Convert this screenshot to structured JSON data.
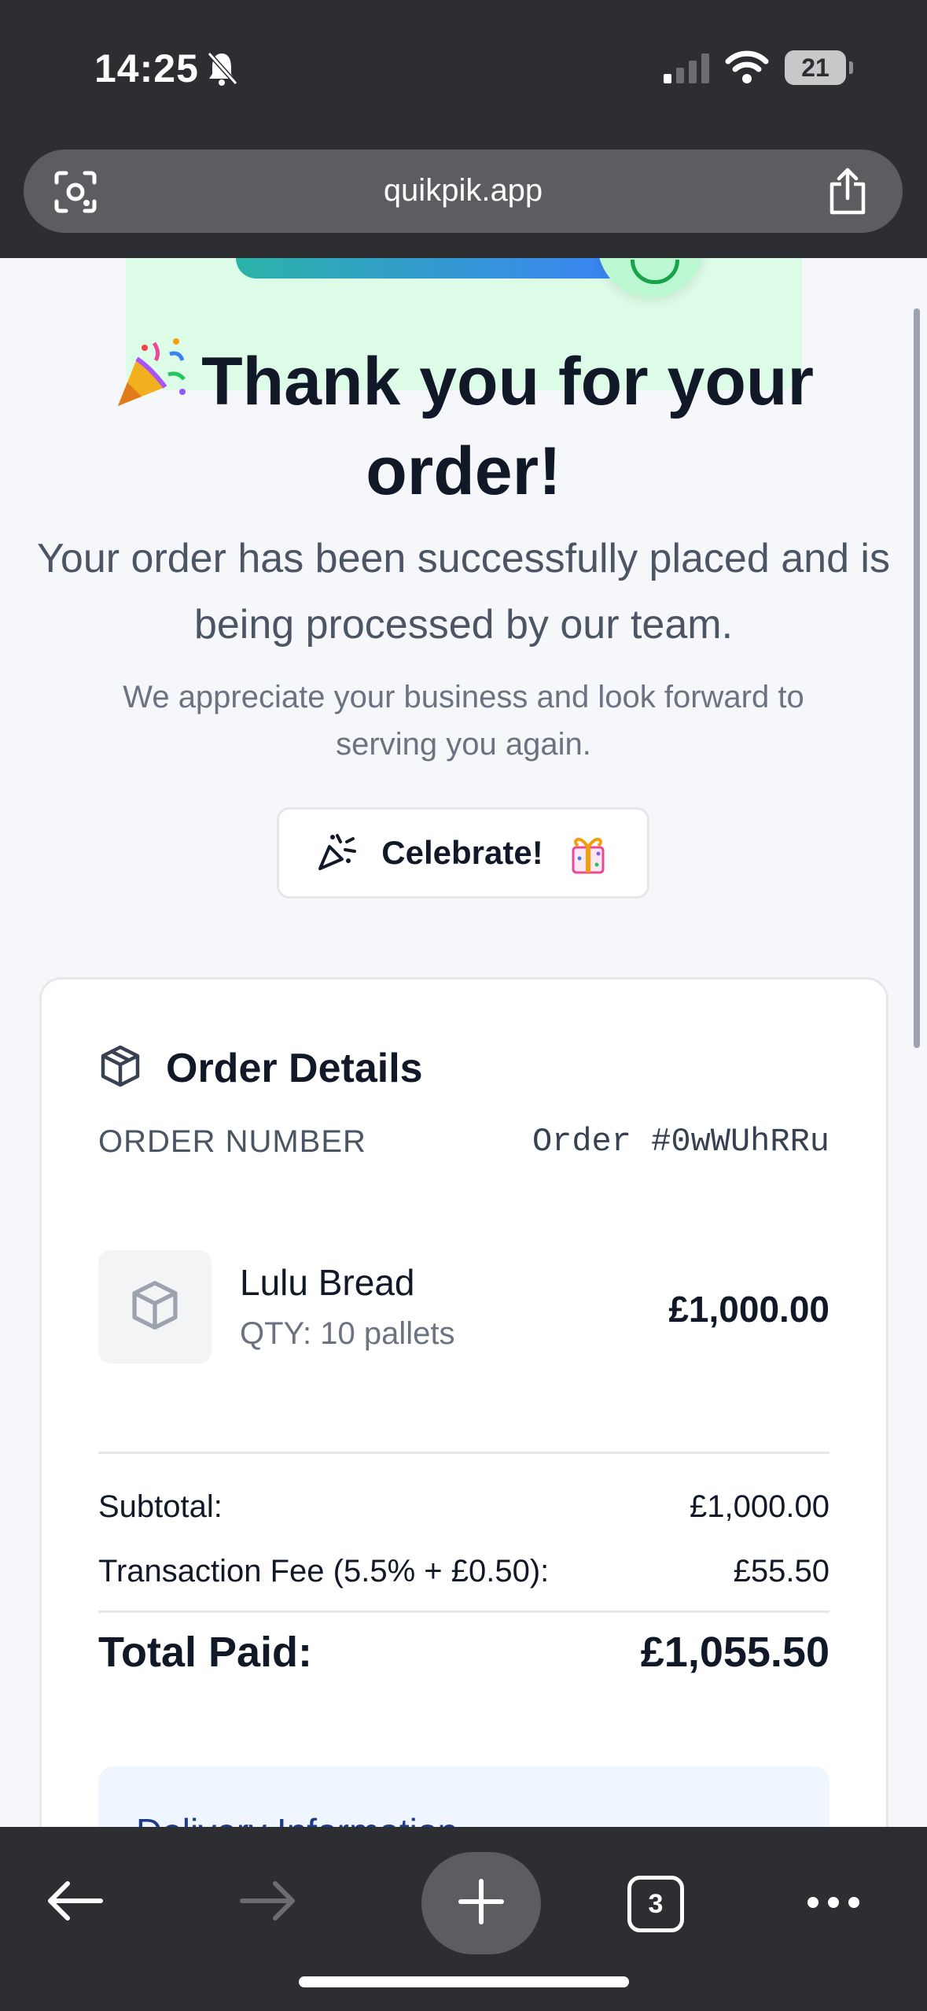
{
  "status_bar": {
    "time": "14:25",
    "battery": "21"
  },
  "browser": {
    "url": "quikpik.app",
    "tab_count": "3"
  },
  "confirmation": {
    "title": "Thank you for your order!",
    "message": "Your order has been successfully placed and is being processed by our team.",
    "appreciation": "We appreciate your business and look forward to serving you again.",
    "celebrate_label": "Celebrate!"
  },
  "order": {
    "section_title": "Order Details",
    "order_number_label": "ORDER NUMBER",
    "order_number": "Order #0wWUhRRu",
    "item": {
      "name": "Lulu Bread",
      "qty": "QTY: 10 pallets",
      "price": "£1,000.00"
    },
    "subtotal_label": "Subtotal:",
    "subtotal_value": "£1,000.00",
    "fee_label": "Transaction Fee (5.5% + £0.50):",
    "fee_value": "£55.50",
    "total_label": "Total Paid:",
    "total_value": "£1,055.50",
    "delivery_title": "Delivery Information"
  },
  "icons": {
    "status": [
      "bell-off-icon",
      "signal-icon",
      "wifi-icon",
      "battery-icon"
    ],
    "browser": [
      "lens-icon",
      "share-icon",
      "back-icon",
      "forward-icon",
      "plus-icon",
      "tabs-icon",
      "more-icon"
    ],
    "content": [
      "party-popper-icon",
      "confetti-icon",
      "gift-icon",
      "package-icon"
    ]
  },
  "colors": {
    "accent_green": "#16a34a",
    "delivery_blue": "#1e3a8a",
    "chrome": "#2c2e31"
  }
}
